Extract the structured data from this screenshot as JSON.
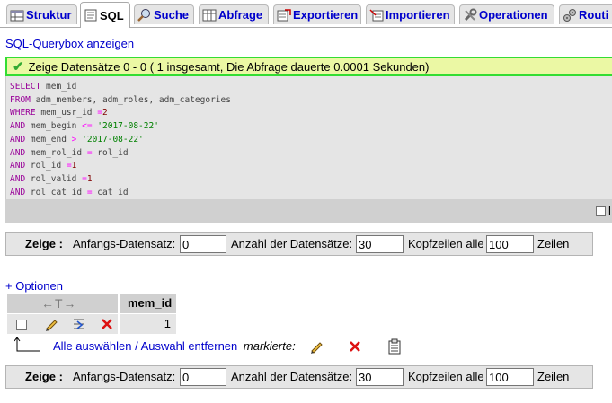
{
  "tabs": [
    {
      "label": "Struktur",
      "icon": "table-structure-icon",
      "active": false
    },
    {
      "label": "SQL",
      "icon": "sql-icon",
      "active": true
    },
    {
      "label": "Suche",
      "icon": "search-icon",
      "active": false
    },
    {
      "label": "Abfrage",
      "icon": "query-icon",
      "active": false
    },
    {
      "label": "Exportieren",
      "icon": "export-icon",
      "active": false
    },
    {
      "label": "Importieren",
      "icon": "import-icon",
      "active": false
    },
    {
      "label": "Operationen",
      "icon": "operations-icon",
      "active": false
    },
    {
      "label": "Routi",
      "icon": "routines-icon",
      "active": false
    }
  ],
  "querybox_link": "SQL-Querybox anzeigen",
  "message": "Zeige Datensätze 0 - 0 ( 1 insgesamt, Die Abfrage dauerte 0.0001 Sekunden)",
  "sql": {
    "lines": [
      [
        {
          "t": "SELECT",
          "c": "kw"
        },
        {
          "t": " mem_id",
          "c": ""
        }
      ],
      [
        {
          "t": "FROM",
          "c": "kw"
        },
        {
          "t": " adm_members, adm_roles, adm_categories",
          "c": ""
        }
      ],
      [
        {
          "t": "WHERE",
          "c": "kw"
        },
        {
          "t": " mem_usr_id ",
          "c": ""
        },
        {
          "t": "=",
          "c": "op"
        },
        {
          "t": "2",
          "c": "num"
        }
      ],
      [
        {
          "t": "AND",
          "c": "kw"
        },
        {
          "t": " mem_begin ",
          "c": ""
        },
        {
          "t": "<=",
          "c": "op"
        },
        {
          "t": " ",
          "c": ""
        },
        {
          "t": "'2017-08-22'",
          "c": "str"
        }
      ],
      [
        {
          "t": "AND",
          "c": "kw"
        },
        {
          "t": " mem_end ",
          "c": ""
        },
        {
          "t": ">",
          "c": "op"
        },
        {
          "t": " ",
          "c": ""
        },
        {
          "t": "'2017-08-22'",
          "c": "str"
        }
      ],
      [
        {
          "t": "AND",
          "c": "kw"
        },
        {
          "t": " mem_rol_id ",
          "c": ""
        },
        {
          "t": "=",
          "c": "op"
        },
        {
          "t": " rol_id",
          "c": ""
        }
      ],
      [
        {
          "t": "AND",
          "c": "kw"
        },
        {
          "t": " rol_id ",
          "c": ""
        },
        {
          "t": "=",
          "c": "op"
        },
        {
          "t": "1",
          "c": "num"
        }
      ],
      [
        {
          "t": "AND",
          "c": "kw"
        },
        {
          "t": " rol_valid ",
          "c": ""
        },
        {
          "t": "=",
          "c": "op"
        },
        {
          "t": "1",
          "c": "num"
        }
      ],
      [
        {
          "t": "AND",
          "c": "kw"
        },
        {
          "t": " rol_cat_id ",
          "c": ""
        },
        {
          "t": "=",
          "c": "op"
        },
        {
          "t": " cat_id",
          "c": ""
        }
      ]
    ],
    "profiling_partial": "l"
  },
  "nav": {
    "label": "Zeige :",
    "start_label": "Anfangs-Datensatz:",
    "start_value": "0",
    "count_label": "Anzahl der Datensätze:",
    "count_value": "30",
    "header_label": "Kopfzeilen alle",
    "header_value": "100",
    "rows_label": "Zeilen"
  },
  "options_link": "+ Optionen",
  "table": {
    "sort_arrows": "←T→",
    "column": "mem_id",
    "rows": [
      {
        "value": "1"
      }
    ]
  },
  "bulk": {
    "select_all": "Alle auswählen",
    "separator": " / ",
    "deselect_all": "Auswahl entfernen",
    "marked_label": "markierte:"
  },
  "colors": {
    "link": "#0000cc",
    "keyword": "#990099",
    "string": "#008000",
    "success_border": "#33dd33",
    "success_bg": "#ebf8a4"
  }
}
